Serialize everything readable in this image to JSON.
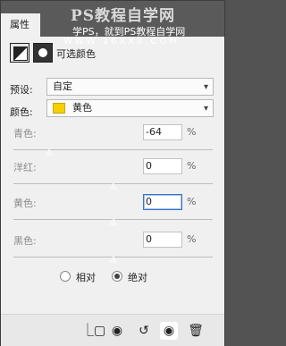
{
  "tab": {
    "label": "属性"
  },
  "watermark": {
    "line1": "PS教程自学网",
    "line2": "学PS，就到PS教程自学网",
    "line3": "WWW.16XX8.COM"
  },
  "header": {
    "title": "可选颜色",
    "adjustment_icon": "adjustment-layer-icon",
    "mask_icon": "layer-mask-icon"
  },
  "preset": {
    "label": "预设:",
    "value": "自定"
  },
  "colors": {
    "label": "颜色:",
    "value": "黄色",
    "swatch": "#f5d000"
  },
  "sliders": [
    {
      "label": "青色:",
      "value": "-64",
      "unit": "%",
      "level": -0.64
    },
    {
      "label": "洋红:",
      "value": "0",
      "unit": "%",
      "level": 0
    },
    {
      "label": "黄色:",
      "value": "0",
      "unit": "%",
      "level": 0
    },
    {
      "label": "黑色:",
      "value": "0",
      "unit": "%",
      "level": 0
    }
  ],
  "method": {
    "relative_label": "相对",
    "absolute_label": "绝对",
    "selected": "absolute"
  },
  "footer": {
    "icons": [
      "clip-to-layer-icon",
      "view-previous-state-icon",
      "reset-icon",
      "visibility-icon",
      "delete-icon"
    ],
    "chevron": "▾",
    "glyphs": [
      "⎿▢",
      "◉",
      "↺",
      "◉",
      "🗑"
    ]
  }
}
